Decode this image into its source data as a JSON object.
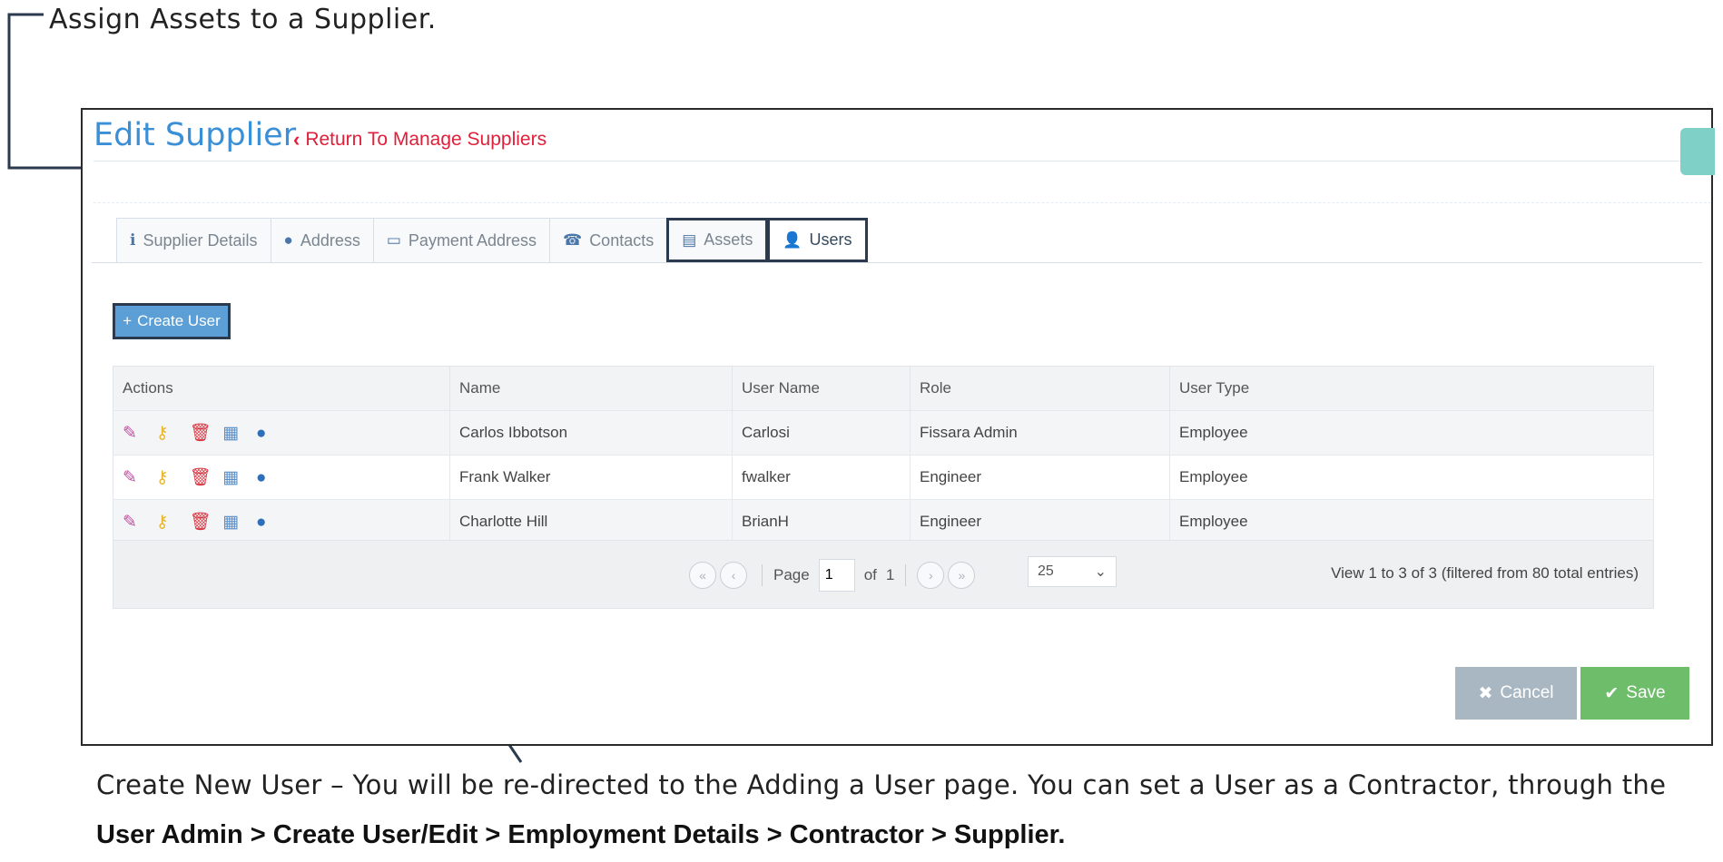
{
  "annotations": {
    "top": "Assign Assets to a Supplier.",
    "bottom": "Create New User – You will be re-directed to the Adding a User page. You can set a User as a Contractor, through the",
    "bottom_path": "User Admin > Create User/Edit > Employment Details > Contractor > Supplier."
  },
  "header": {
    "title": "Edit Supplier",
    "return_link": "Return To Manage Suppliers"
  },
  "tabs": [
    {
      "label": "Supplier Details",
      "icon": "info-icon"
    },
    {
      "label": "Address",
      "icon": "globe-icon"
    },
    {
      "label": "Payment Address",
      "icon": "credit-card-icon"
    },
    {
      "label": "Contacts",
      "icon": "phone-icon"
    },
    {
      "label": "Assets",
      "icon": "archive-icon"
    },
    {
      "label": "Users",
      "icon": "user-icon"
    }
  ],
  "active_tab": "Users",
  "create_button": "Create User",
  "table": {
    "columns": [
      "Actions",
      "Name",
      "User Name",
      "Role",
      "User Type"
    ],
    "rows": [
      {
        "name": "Carlos Ibbotson",
        "username": "Carlosi",
        "role": "Fissara Admin",
        "type": "Employee"
      },
      {
        "name": "Frank Walker",
        "username": "fwalker",
        "role": "Engineer",
        "type": "Employee"
      },
      {
        "name": "Charlotte Hill",
        "username": "BrianH",
        "role": "Engineer",
        "type": "Employee"
      }
    ],
    "action_icons": [
      "pencil-icon",
      "key-icon",
      "trash-icon",
      "edit-note-icon",
      "globe-icon"
    ]
  },
  "pager": {
    "page_label": "Page",
    "page_value": "1",
    "of_label": "of",
    "total_pages": "1",
    "per_page": "25",
    "view_info": "View 1 to 3 of 3 (filtered from 80 total entries)"
  },
  "buttons": {
    "cancel": "Cancel",
    "save": "Save"
  },
  "colors": {
    "title_blue": "#3a8fd6",
    "link_red": "#e0203a",
    "create_blue": "#5b9fd6",
    "save_green": "#6dbd6a",
    "cancel_grey": "#a9b7c2"
  }
}
